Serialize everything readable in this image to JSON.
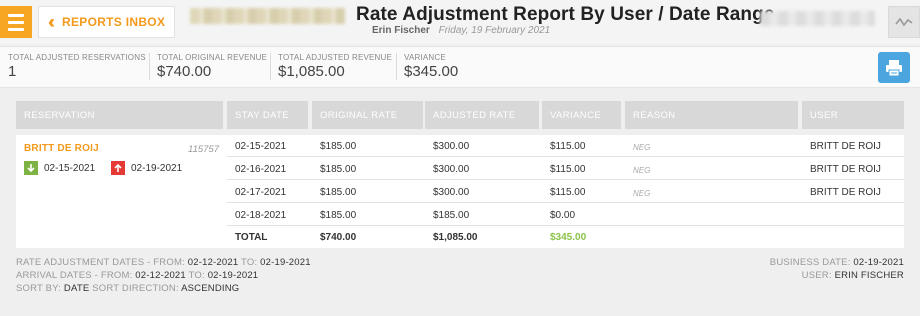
{
  "header": {
    "back_label": "REPORTS INBOX",
    "title": "Rate Adjustment Report By User / Date Range",
    "user": "Erin Fischer",
    "date": "Friday, 19 February 2021"
  },
  "stats": [
    {
      "label": "TOTAL ADJUSTED RESERVATIONS",
      "value": "1"
    },
    {
      "label": "TOTAL ORIGINAL REVENUE",
      "value": "$740.00"
    },
    {
      "label": "TOTAL ADJUSTED REVENUE",
      "value": "$1,085.00"
    },
    {
      "label": "VARIANCE",
      "value": "$345.00"
    }
  ],
  "table": {
    "columns": [
      "RESERVATION",
      "STAY DATE",
      "ORIGINAL RATE",
      "ADJUSTED RATE",
      "VARIANCE",
      "REASON",
      "USER"
    ],
    "reservation": {
      "guest": "BRITT DE ROIJ",
      "number": "115757",
      "arrival": "02-15-2021",
      "departure": "02-19-2021"
    },
    "rows": [
      {
        "stay_date": "02-15-2021",
        "original": "$185.00",
        "adjusted": "$300.00",
        "variance": "$115.00",
        "reason": "NEG",
        "user": "BRITT DE ROIJ"
      },
      {
        "stay_date": "02-16-2021",
        "original": "$185.00",
        "adjusted": "$300.00",
        "variance": "$115.00",
        "reason": "NEG",
        "user": "BRITT DE ROIJ"
      },
      {
        "stay_date": "02-17-2021",
        "original": "$185.00",
        "adjusted": "$300.00",
        "variance": "$115.00",
        "reason": "NEG",
        "user": "BRITT DE ROIJ"
      },
      {
        "stay_date": "02-18-2021",
        "original": "$185.00",
        "adjusted": "$185.00",
        "variance": "$0.00",
        "reason": "",
        "user": ""
      }
    ],
    "total": {
      "label": "TOTAL",
      "original": "$740.00",
      "adjusted": "$1,085.00",
      "variance": "$345.00"
    }
  },
  "footer": {
    "rate_dates_label": "RATE ADJUSTMENT DATES - FROM:",
    "rate_from": "02-12-2021",
    "to_label": "TO:",
    "rate_to": "02-19-2021",
    "arrival_label": "ARRIVAL DATES - FROM:",
    "arrival_from": "02-12-2021",
    "arrival_to": "02-19-2021",
    "sort_by_label": "SORT BY:",
    "sort_by": "DATE",
    "sort_dir_label": "SORT DIRECTION:",
    "sort_dir": "ASCENDING",
    "business_date_label": "BUSINESS DATE:",
    "business_date": "02-19-2021",
    "user_label": "USER:",
    "user": "ERIN FISCHER"
  },
  "colors": {
    "accent": "#f39a1d",
    "print": "#4ba5de",
    "positive": "#8bc34a",
    "arrival": "#7cb342",
    "departure": "#e53935"
  },
  "icons": [
    "menu-icon",
    "double-chevron-left-icon",
    "chart-line-icon",
    "printer-icon",
    "arrow-down-icon",
    "arrow-up-icon"
  ]
}
